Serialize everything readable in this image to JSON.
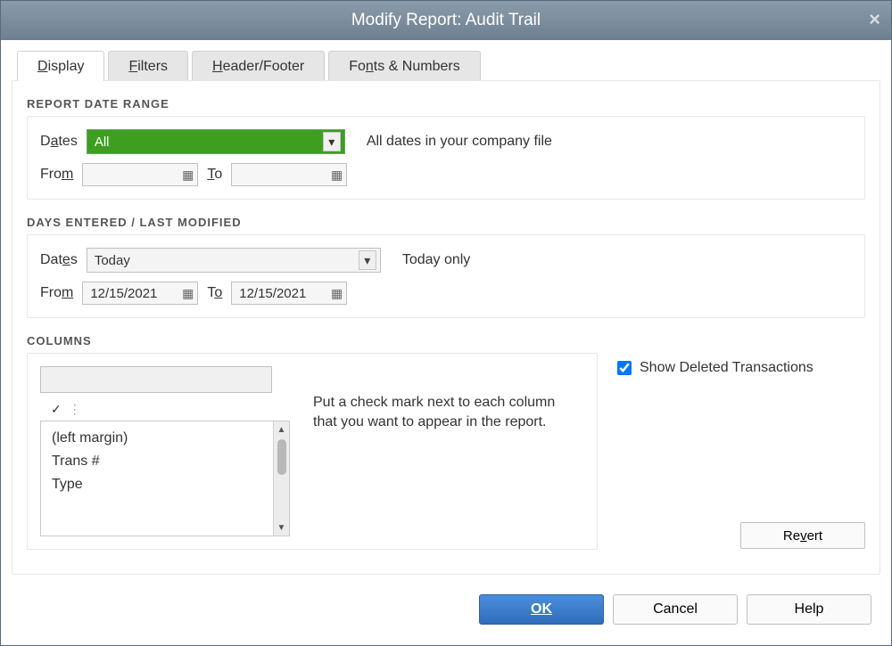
{
  "title": "Modify Report: Audit Trail",
  "tabs": [
    {
      "label": "Display",
      "ul_index": 0,
      "active": true
    },
    {
      "label": "Filters",
      "ul_index": 0,
      "active": false
    },
    {
      "label": "Header/Footer",
      "ul_index": 0,
      "active": false
    },
    {
      "label": "Fonts & Numbers",
      "ul_index": 2,
      "active": false
    }
  ],
  "section1": {
    "title": "REPORT DATE RANGE",
    "dates_label": "Dates",
    "dates_value": "All",
    "dates_desc": "All dates in your company file",
    "from_label": "From",
    "from_value": "",
    "to_label": "To",
    "to_value": ""
  },
  "section2": {
    "title": "DAYS ENTERED / LAST MODIFIED",
    "dates_label": "Dates",
    "dates_value": "Today",
    "dates_desc": "Today only",
    "from_label": "From",
    "from_value": "12/15/2021",
    "to_label": "To",
    "to_value": "12/15/2021"
  },
  "columns": {
    "title": "COLUMNS",
    "items": [
      "(left margin)",
      "Trans #",
      "Type"
    ],
    "hint": "Put a check mark next to each column that you want to appear in the report."
  },
  "show_deleted_label": "Show Deleted Transactions",
  "show_deleted_checked": true,
  "buttons": {
    "revert": "Revert",
    "ok": "OK",
    "cancel": "Cancel",
    "help": "Help"
  }
}
